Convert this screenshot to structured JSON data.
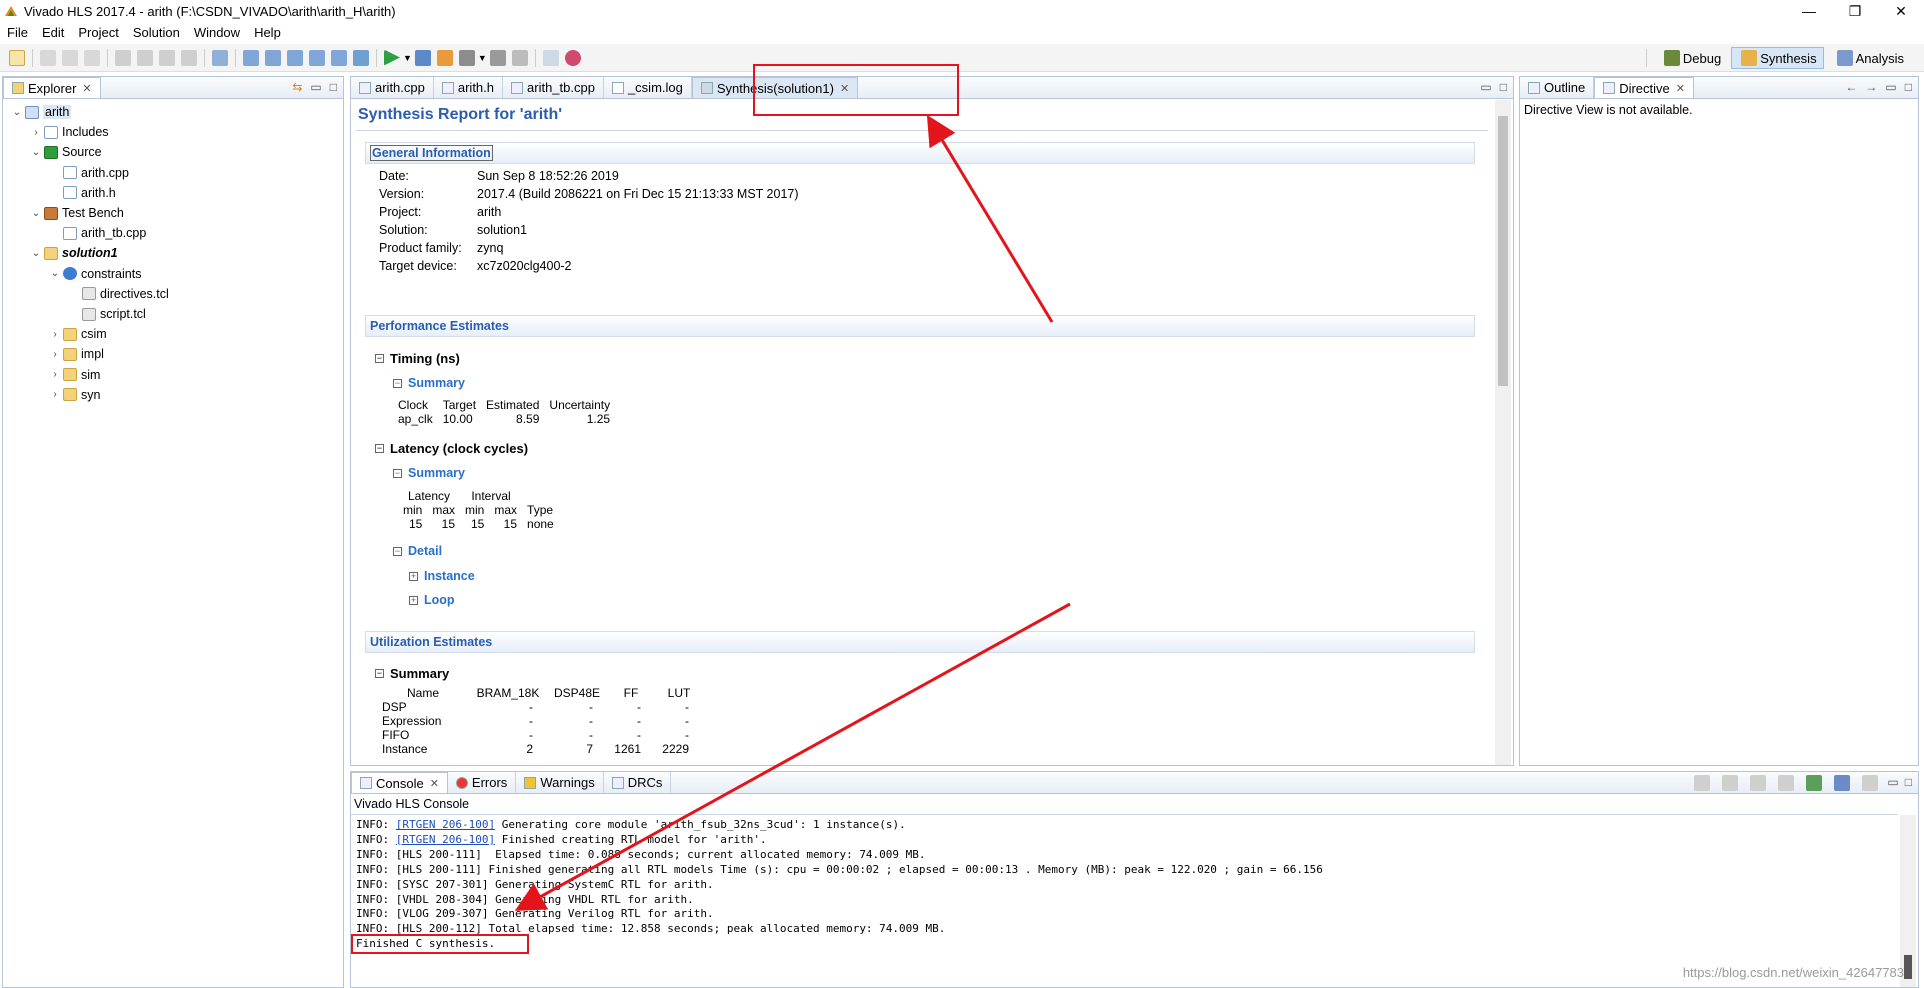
{
  "window": {
    "title": "Vivado HLS 2017.4 - arith (F:\\CSDN_VIVADO\\arith\\arith_H\\arith)",
    "controls": [
      "—",
      "❐",
      "✕"
    ]
  },
  "menu": [
    "File",
    "Edit",
    "Project",
    "Solution",
    "Window",
    "Help"
  ],
  "perspectives": [
    "Debug",
    "Synthesis",
    "Analysis"
  ],
  "explorer": {
    "tab": "Explorer",
    "tree": [
      {
        "label": "arith",
        "level": 0,
        "expanded": true,
        "icon": "project-icon"
      },
      {
        "label": "Includes",
        "level": 1,
        "expanded": false,
        "icon": "includes-icon"
      },
      {
        "label": "Source",
        "level": 1,
        "expanded": true,
        "icon": "source-icon"
      },
      {
        "label": "arith.cpp",
        "level": 2,
        "icon": "file-icon"
      },
      {
        "label": "arith.h",
        "level": 2,
        "icon": "file-icon"
      },
      {
        "label": "Test Bench",
        "level": 1,
        "expanded": true,
        "icon": "testbench-icon"
      },
      {
        "label": "arith_tb.cpp",
        "level": 2,
        "icon": "file-icon"
      },
      {
        "label": "solution1",
        "level": 1,
        "expanded": true,
        "icon": "solution-icon"
      },
      {
        "label": "constraints",
        "level": 2,
        "expanded": true,
        "icon": "gear-icon"
      },
      {
        "label": "directives.tcl",
        "level": 3,
        "icon": "tcl-icon"
      },
      {
        "label": "script.tcl",
        "level": 3,
        "icon": "tcl-icon"
      },
      {
        "label": "csim",
        "level": 2,
        "expanded": false,
        "icon": "folder-icon"
      },
      {
        "label": "impl",
        "level": 2,
        "expanded": false,
        "icon": "folder-icon"
      },
      {
        "label": "sim",
        "level": 2,
        "expanded": false,
        "icon": "folder-icon"
      },
      {
        "label": "syn",
        "level": 2,
        "expanded": false,
        "icon": "folder-icon"
      }
    ]
  },
  "editor": {
    "tabs": [
      "arith.cpp",
      "arith.h",
      "arith_tb.cpp",
      "_csim.log",
      "Synthesis(solution1)"
    ],
    "active_tab": 4
  },
  "report": {
    "title": "Synthesis Report for 'arith'",
    "general": {
      "header": "General Information",
      "rows": [
        {
          "k": "Date:",
          "v": "Sun Sep 8 18:52:26 2019"
        },
        {
          "k": "Version:",
          "v": "2017.4 (Build 2086221 on Fri Dec 15 21:13:33 MST 2017)"
        },
        {
          "k": "Project:",
          "v": "arith"
        },
        {
          "k": "Solution:",
          "v": "solution1"
        },
        {
          "k": "Product family:",
          "v": "zynq"
        },
        {
          "k": "Target device:",
          "v": "xc7z020clg400-2"
        }
      ]
    },
    "performance": {
      "header": "Performance Estimates",
      "timing_title": "Timing (ns)",
      "timing_summary": "Summary",
      "timing_cols": [
        "Clock",
        "Target",
        "Estimated",
        "Uncertainty"
      ],
      "timing_row": [
        "ap_clk",
        "10.00",
        "8.59",
        "1.25"
      ],
      "latency_title": "Latency (clock cycles)",
      "latency_summary": "Summary",
      "latency_groups": [
        "Latency",
        "Interval"
      ],
      "latency_cols": [
        "min",
        "max",
        "min",
        "max",
        "Type"
      ],
      "latency_row": [
        "15",
        "15",
        "15",
        "15",
        "none"
      ],
      "detail": "Detail",
      "detail_items": [
        "Instance",
        "Loop"
      ]
    },
    "utilization": {
      "header": "Utilization Estimates",
      "summary": "Summary",
      "cols": [
        "Name",
        "BRAM_18K",
        "DSP48E",
        "FF",
        "LUT"
      ],
      "rows": [
        [
          "DSP",
          "-",
          "-",
          "-",
          "-"
        ],
        [
          "Expression",
          "-",
          "-",
          "-",
          "-"
        ],
        [
          "FIFO",
          "-",
          "-",
          "-",
          "-"
        ],
        [
          "Instance",
          "2",
          "7",
          "1261",
          "2229"
        ]
      ]
    }
  },
  "right_panel": {
    "tabs": [
      "Outline",
      "Directive"
    ],
    "message": "Directive View is not available."
  },
  "console": {
    "tabs": [
      "Console",
      "Errors",
      "Warnings",
      "DRCs"
    ],
    "title": "Vivado HLS Console",
    "lines": [
      {
        "pre": "INFO: ",
        "link": "[RTGEN 206-100]",
        "post": " Generating core module 'arith_fsub_32ns_3cud': 1 instance(s)."
      },
      {
        "pre": "INFO: ",
        "link": "[RTGEN 206-100]",
        "post": " Finished creating RTL model for 'arith'."
      },
      {
        "pre": "INFO: [HLS 200-111]  Elapsed time: 0.088 seconds; current allocated memory: 74.009 MB.",
        "link": "",
        "post": ""
      },
      {
        "pre": "INFO: [HLS 200-111] Finished generating all RTL models Time (s): cpu = 00:00:02 ; elapsed = 00:00:13 . Memory (MB): peak = 122.020 ; gain = 66.156",
        "link": "",
        "post": ""
      },
      {
        "pre": "INFO: [SYSC 207-301] Generating SystemC RTL for arith.",
        "link": "",
        "post": ""
      },
      {
        "pre": "INFO: [VHDL 208-304] Generating VHDL RTL for arith.",
        "link": "",
        "post": ""
      },
      {
        "pre": "INFO: [VLOG 209-307] Generating Verilog RTL for arith.",
        "link": "",
        "post": ""
      },
      {
        "pre": "INFO: [HLS 200-112] Total elapsed time: 12.858 seconds; peak allocated memory: 74.009 MB.",
        "link": "",
        "post": ""
      },
      {
        "pre": "Finished C synthesis.",
        "link": "",
        "post": ""
      }
    ]
  },
  "watermark": "https://blog.csdn.net/weixin_42647783",
  "colors": {
    "annotation_red": "#e4141b",
    "link_blue": "#2a6fc9",
    "header_blue": "#2a5db0"
  }
}
